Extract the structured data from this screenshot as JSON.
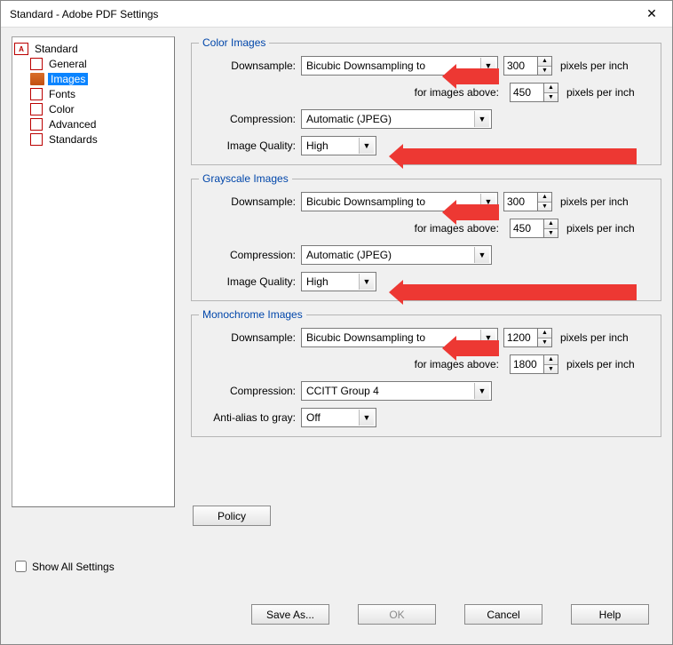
{
  "window": {
    "title": "Standard - Adobe PDF Settings"
  },
  "tree": {
    "root": "Standard",
    "items": [
      "General",
      "Images",
      "Fonts",
      "Color",
      "Advanced",
      "Standards"
    ],
    "selected": "Images"
  },
  "labels": {
    "downsample": "Downsample:",
    "compression": "Compression:",
    "quality": "Image Quality:",
    "antialias": "Anti-alias to gray:",
    "for_above": "for images above:",
    "ppi": "pixels per inch",
    "show_all": "Show All Settings",
    "policy": "Policy",
    "save_as": "Save As...",
    "ok": "OK",
    "cancel": "Cancel",
    "help": "Help"
  },
  "color_group": {
    "legend": "Color Images",
    "downsample_method": "Bicubic Downsampling to",
    "downsample_value": "300",
    "above_value": "450",
    "compression": "Automatic (JPEG)",
    "quality": "High"
  },
  "gray_group": {
    "legend": "Grayscale Images",
    "downsample_method": "Bicubic Downsampling to",
    "downsample_value": "300",
    "above_value": "450",
    "compression": "Automatic (JPEG)",
    "quality": "High"
  },
  "mono_group": {
    "legend": "Monochrome Images",
    "downsample_method": "Bicubic Downsampling to",
    "downsample_value": "1200",
    "above_value": "1800",
    "compression": "CCITT Group 4",
    "antialias": "Off"
  }
}
